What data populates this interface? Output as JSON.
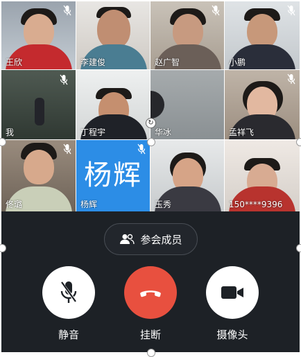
{
  "participants": [
    {
      "name": "王欣",
      "muted": true
    },
    {
      "name": "李建俊",
      "muted": false
    },
    {
      "name": "赵广智",
      "muted": true
    },
    {
      "name": "小鹏",
      "muted": true
    },
    {
      "name": "我",
      "muted": true
    },
    {
      "name": "丁程宇",
      "muted": false
    },
    {
      "name": "华冰",
      "muted": false
    },
    {
      "name": "孟祥飞",
      "muted": true
    },
    {
      "name": "佟璐",
      "muted": true
    },
    {
      "name": "杨辉",
      "avatar_text": "杨辉",
      "muted": true
    },
    {
      "name": "玉秀",
      "muted": false
    },
    {
      "name": "150****9396",
      "muted": false
    }
  ],
  "members_button": {
    "label": "参会成员",
    "icon": "people-icon"
  },
  "controls": {
    "mute": {
      "label": "静音",
      "icon": "mic-muted-icon"
    },
    "hangup": {
      "label": "挂断",
      "icon": "phone-hangup-icon"
    },
    "camera": {
      "label": "摄像头",
      "icon": "video-camera-icon"
    }
  },
  "colors": {
    "panel": "#1d2126",
    "hangup": "#e8503f",
    "avatar_tile": "#2c8de6",
    "control_bg": "#ffffff"
  }
}
